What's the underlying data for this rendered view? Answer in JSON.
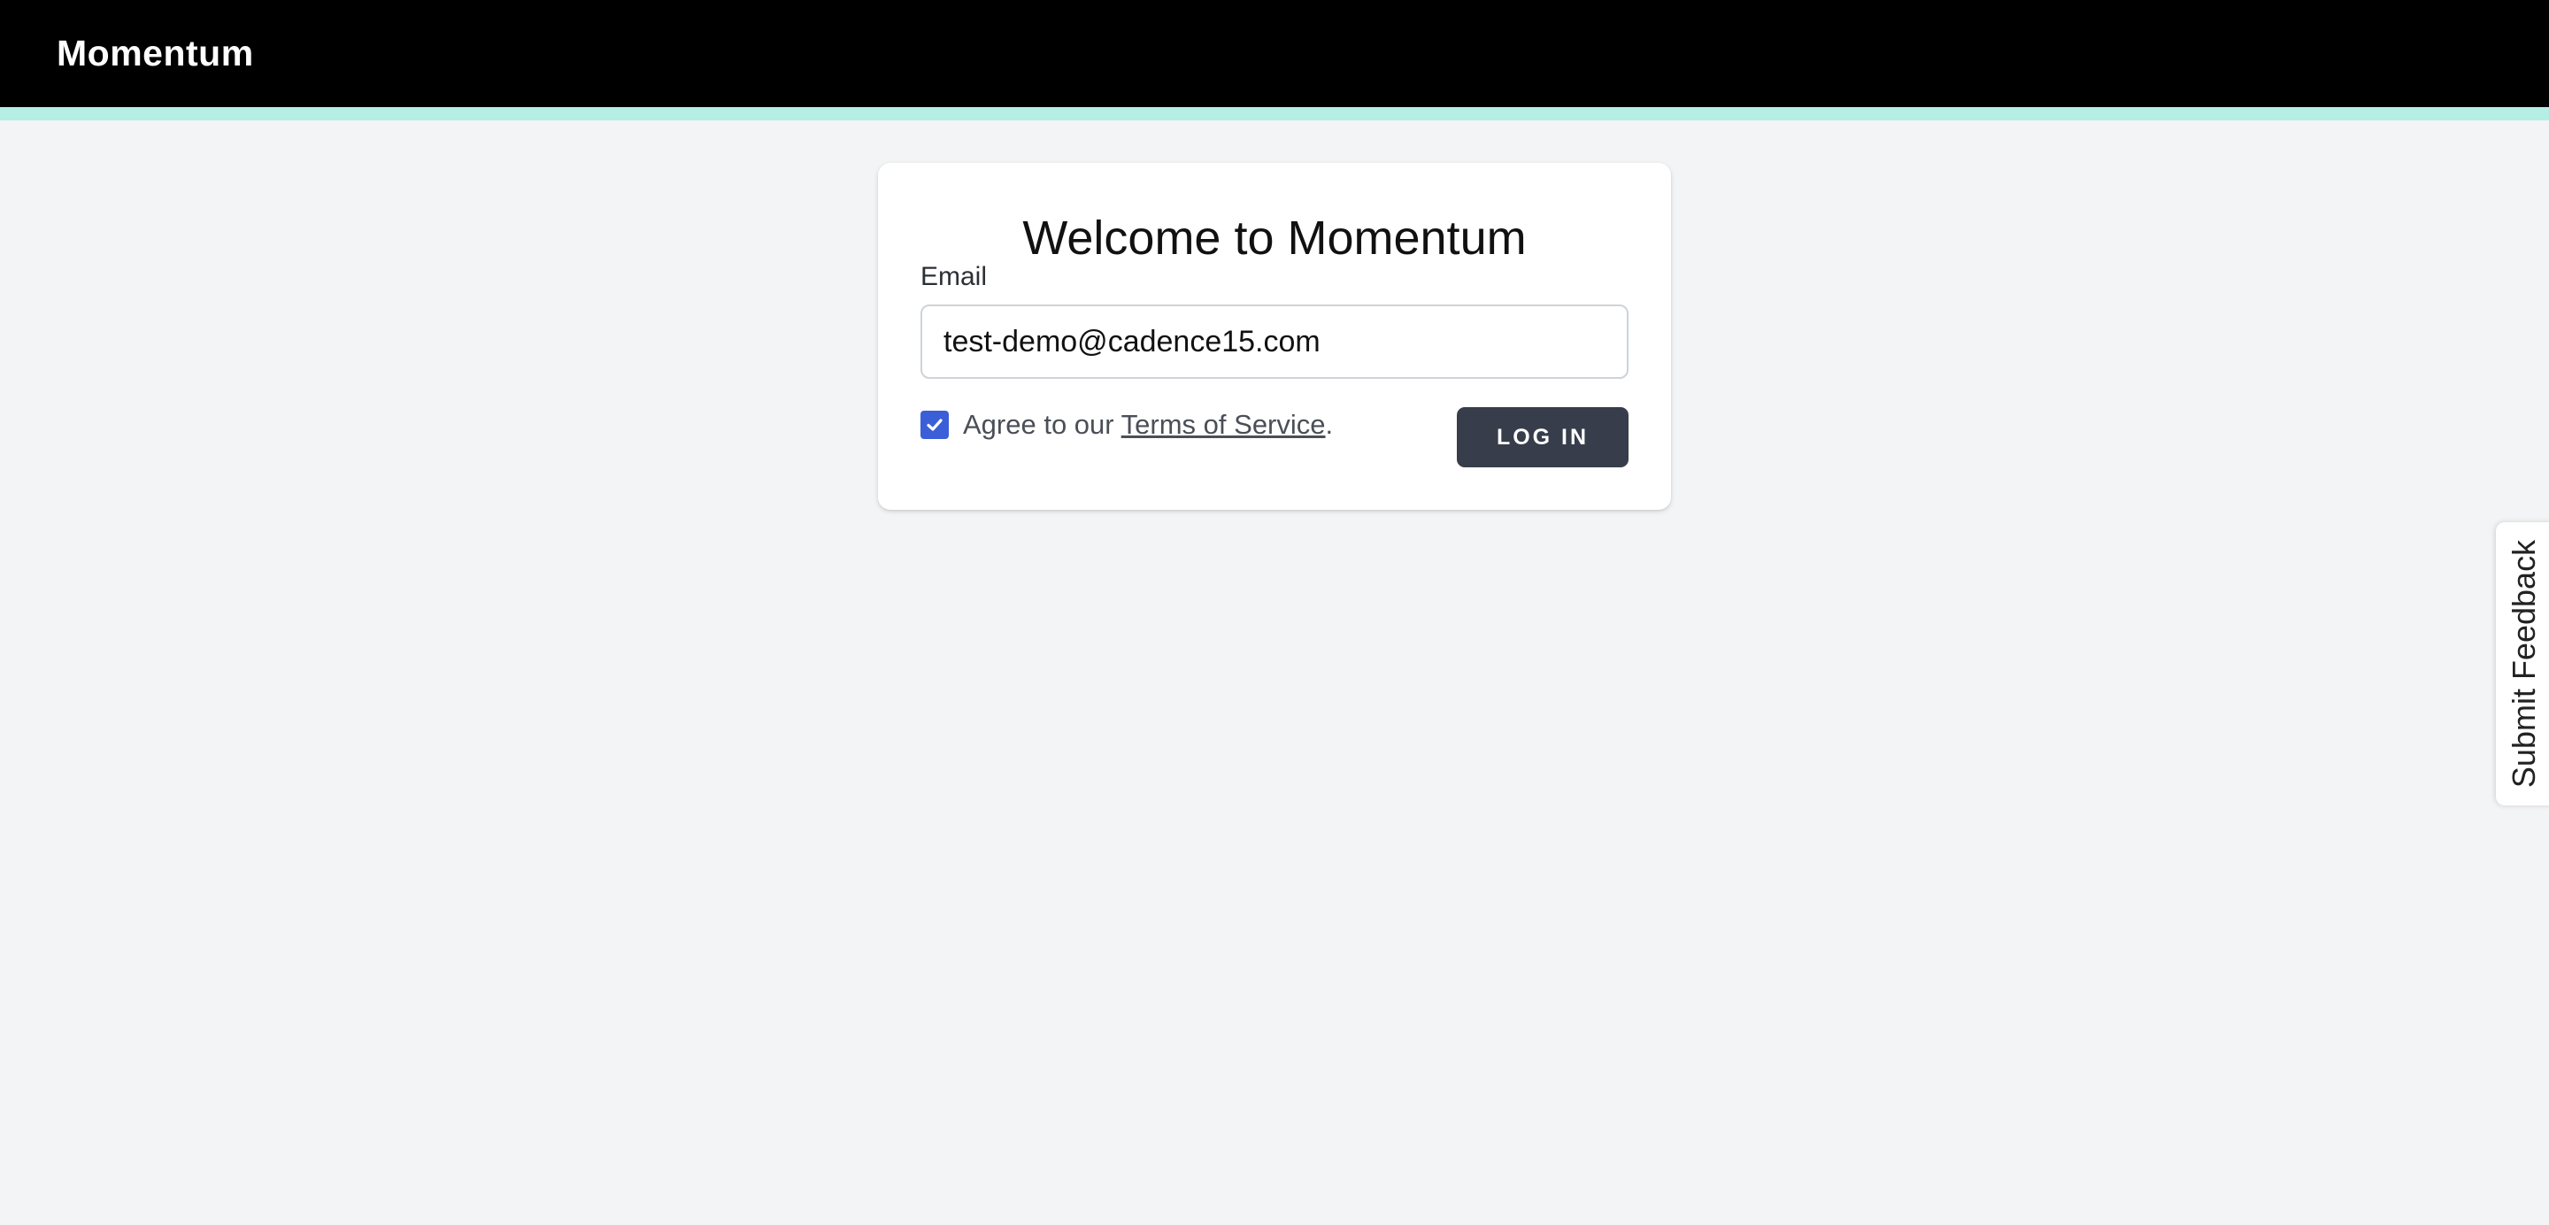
{
  "header": {
    "brand": "Momentum"
  },
  "login_card": {
    "title": "Welcome to Momentum",
    "email_label": "Email",
    "email_value": "test-demo@cadence15.com",
    "agree_prefix": "Agree to our ",
    "terms_link": "Terms of Service",
    "agree_suffix": ".",
    "terms_checked": true,
    "login_label": "LOG IN"
  },
  "feedback": {
    "label": "Submit Feedback"
  },
  "colors": {
    "header_bg": "#000000",
    "accent_strip": "#b4eee4",
    "page_bg": "#f2f4f5",
    "checkbox": "#3a5fd9",
    "button_bg": "#373d4b"
  },
  "icons": {
    "checkbox_check": "checkmark-icon"
  }
}
